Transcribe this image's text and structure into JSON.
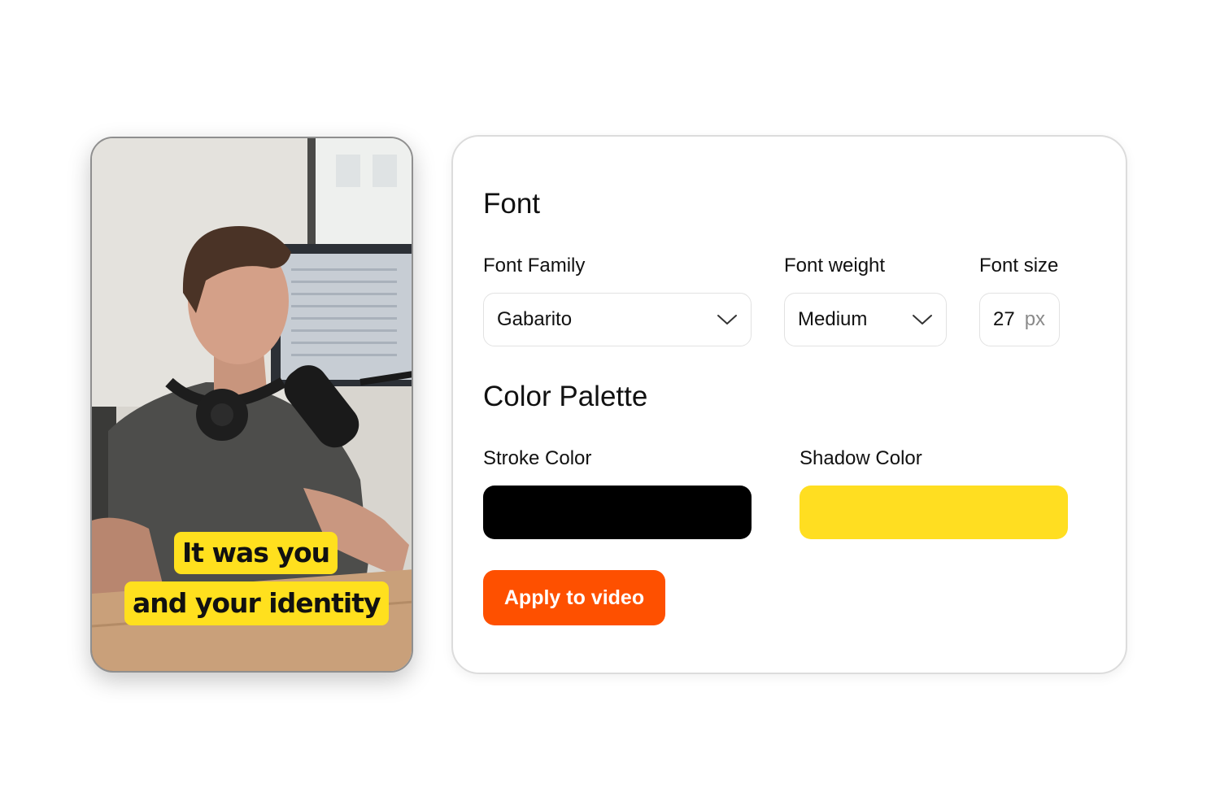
{
  "video_preview": {
    "caption_line_1": "It was you",
    "caption_line_2": "and your identity",
    "caption_highlight_color": "#ffe01e"
  },
  "panel": {
    "font_section": {
      "title": "Font",
      "font_family": {
        "label": "Font Family",
        "value": "Gabarito"
      },
      "font_weight": {
        "label": "Font weight",
        "value": "Medium"
      },
      "font_size": {
        "label": "Font size",
        "value": "27",
        "unit": "px"
      }
    },
    "color_section": {
      "title": "Color Palette",
      "stroke": {
        "label": "Stroke Color",
        "color": "#000000"
      },
      "shadow": {
        "label": "Shadow Color",
        "color": "#ffde21"
      }
    },
    "apply_button": {
      "label": "Apply to video",
      "color": "#fe5000"
    }
  }
}
